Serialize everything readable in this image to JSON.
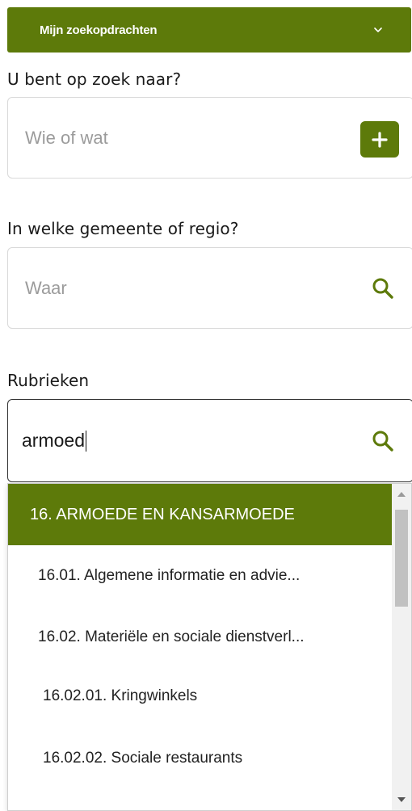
{
  "header": {
    "my_searches_label": "Mijn zoekopdrachten"
  },
  "who": {
    "label": "U bent op zoek naar?",
    "placeholder": "Wie of wat"
  },
  "where": {
    "label": "In welke gemeente of regio?",
    "placeholder": "Waar"
  },
  "categories": {
    "label": "Rubrieken",
    "value": "armoed"
  },
  "dropdown": {
    "items": [
      {
        "label": "16. ARMOEDE EN KANSARMOEDE",
        "selected": true
      },
      {
        "label": "16.01. Algemene informatie en advie..."
      },
      {
        "label": "16.02. Materiële en sociale dienstverl..."
      },
      {
        "label": "16.02.01. Kringwinkels"
      },
      {
        "label": "16.02.02. Sociale restaurants"
      }
    ]
  },
  "colors": {
    "accent": "#5d7a0a",
    "border": "#d9d9d9",
    "placeholder": "#9b9b9b"
  },
  "icons": [
    "chevron-down-icon",
    "plus-icon",
    "search-icon"
  ]
}
